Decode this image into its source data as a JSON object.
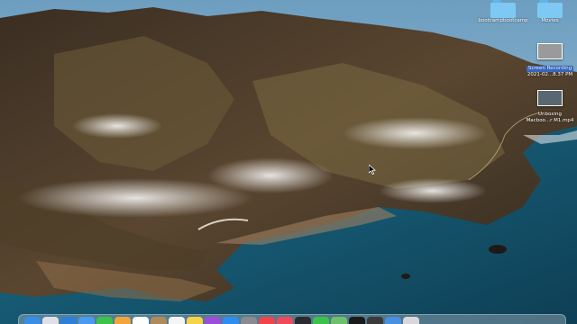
{
  "desktop": {
    "icons": [
      {
        "name": "folder",
        "label": "bootcampbootcamp",
        "type": "folder"
      },
      {
        "name": "movies",
        "label": "Movies",
        "type": "folder"
      },
      {
        "name": "screen-recording",
        "label": "Screen Recording",
        "label2": "2021-02...8.37 PM",
        "type": "file"
      },
      {
        "name": "unboxing",
        "label": "Unboxing",
        "label2": "Macboo...r M1.mp4",
        "type": "video"
      }
    ]
  },
  "dock": {
    "apps": [
      {
        "name": "finder",
        "color": "#3a8ee6"
      },
      {
        "name": "launchpad",
        "color": "#e0e0e8"
      },
      {
        "name": "safari",
        "color": "#2f7fd9"
      },
      {
        "name": "mail",
        "color": "#4a9af0"
      },
      {
        "name": "messages",
        "color": "#3ec24a"
      },
      {
        "name": "photos",
        "color": "#f2a53a"
      },
      {
        "name": "calendar",
        "color": "#ffffff"
      },
      {
        "name": "contacts",
        "color": "#b08a5a"
      },
      {
        "name": "reminders",
        "color": "#f5f5f5"
      },
      {
        "name": "notes",
        "color": "#f7d34a"
      },
      {
        "name": "podcasts",
        "color": "#9b4fd9"
      },
      {
        "name": "appstore",
        "color": "#2d8ef0"
      },
      {
        "name": "settings",
        "color": "#8a8a90"
      },
      {
        "name": "news",
        "color": "#f0444a"
      },
      {
        "name": "music",
        "color": "#f04a5a"
      },
      {
        "name": "quicktime",
        "color": "#2a2a30"
      },
      {
        "name": "facetime",
        "color": "#3cc24a"
      },
      {
        "name": "maps",
        "color": "#6ec06a"
      },
      {
        "name": "terminal",
        "color": "#1a1a1a"
      },
      {
        "name": "activity-monitor",
        "color": "#3a3a3a"
      },
      {
        "name": "downloads",
        "color": "#4a90e0"
      },
      {
        "name": "trash",
        "color": "#d8d8dc"
      }
    ]
  }
}
